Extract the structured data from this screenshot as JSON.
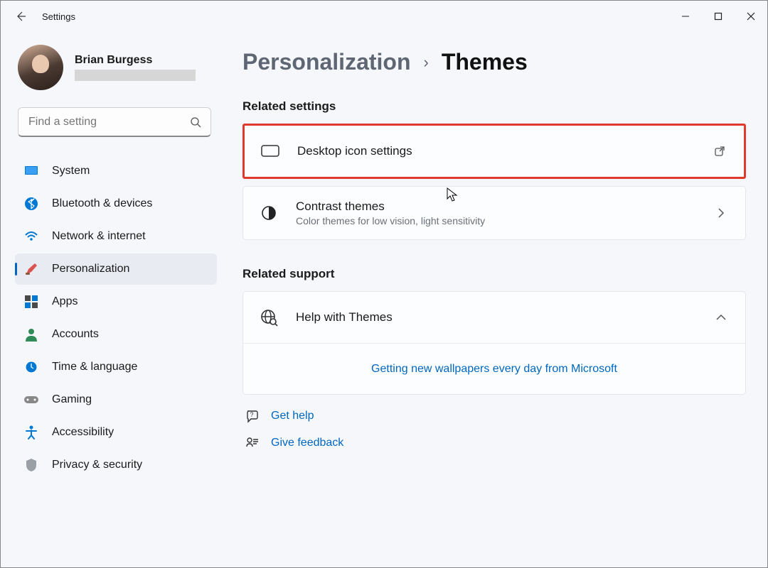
{
  "window": {
    "title": "Settings"
  },
  "user": {
    "name": "Brian Burgess"
  },
  "search": {
    "placeholder": "Find a setting"
  },
  "nav": {
    "items": [
      {
        "label": "System"
      },
      {
        "label": "Bluetooth & devices"
      },
      {
        "label": "Network & internet"
      },
      {
        "label": "Personalization"
      },
      {
        "label": "Apps"
      },
      {
        "label": "Accounts"
      },
      {
        "label": "Time & language"
      },
      {
        "label": "Gaming"
      },
      {
        "label": "Accessibility"
      },
      {
        "label": "Privacy & security"
      }
    ]
  },
  "breadcrumb": {
    "parent": "Personalization",
    "current": "Themes"
  },
  "sections": {
    "related_settings": {
      "title": "Related settings",
      "desktop_icons": "Desktop icon settings",
      "contrast_title": "Contrast themes",
      "contrast_sub": "Color themes for low vision, light sensitivity"
    },
    "related_support": {
      "title": "Related support",
      "help_title": "Help with Themes",
      "wallpaper_link": "Getting new wallpapers every day from Microsoft"
    },
    "help": {
      "get_help": "Get help",
      "feedback": "Give feedback"
    }
  }
}
